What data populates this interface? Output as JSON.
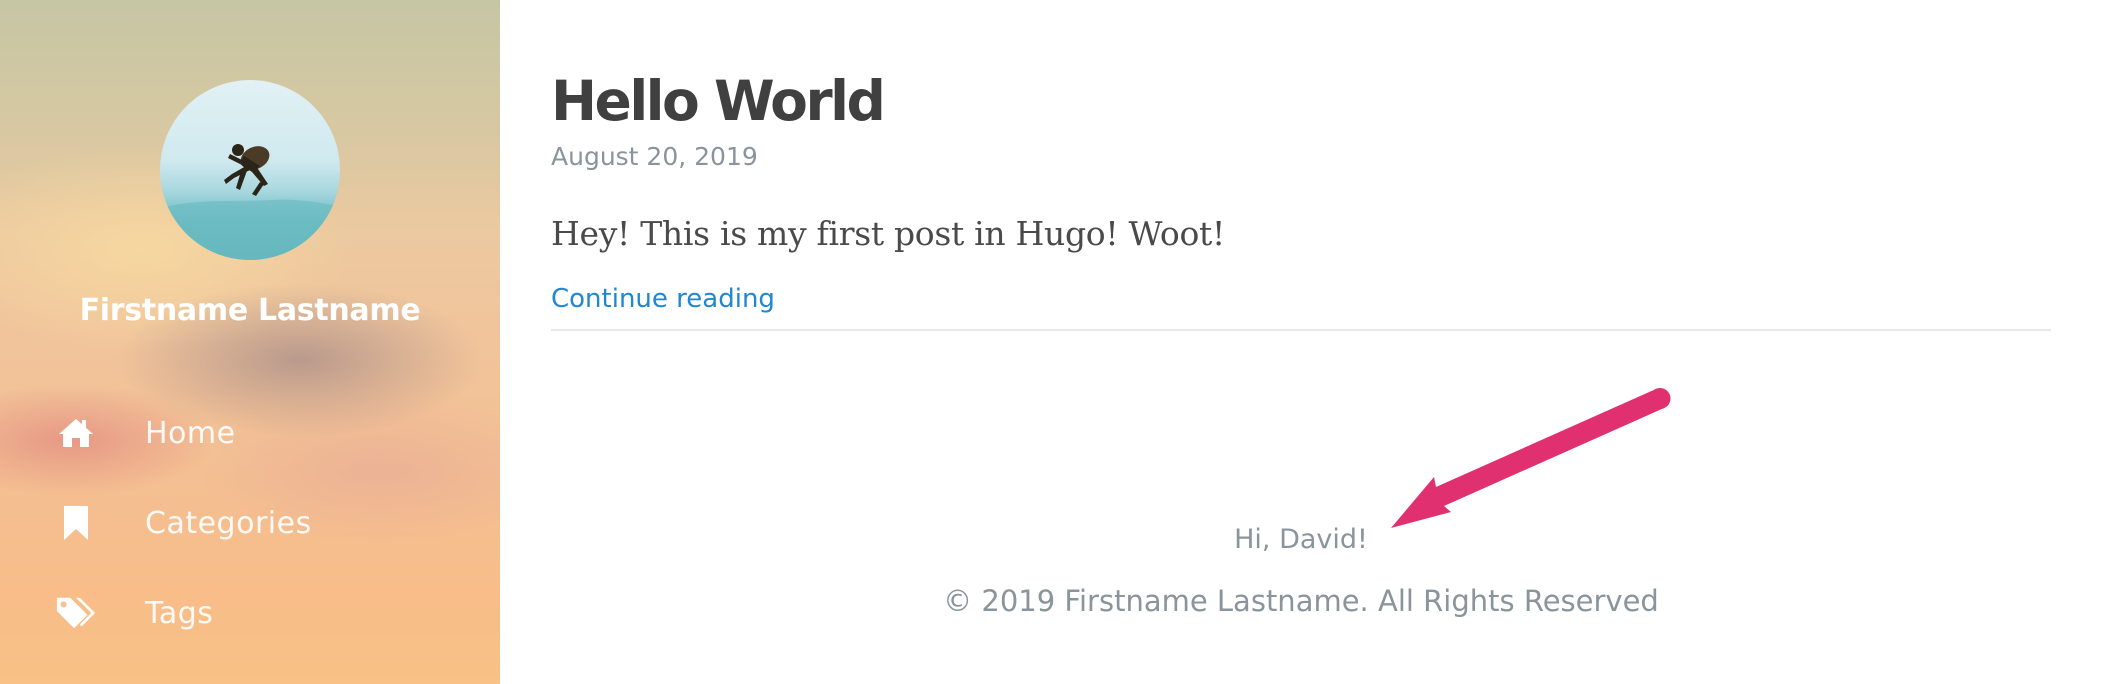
{
  "sidebar": {
    "author_name": "Firstname Lastname",
    "nav": [
      {
        "label": "Home",
        "icon": "home-icon"
      },
      {
        "label": "Categories",
        "icon": "bookmark-icon"
      },
      {
        "label": "Tags",
        "icon": "tags-icon"
      }
    ]
  },
  "post": {
    "title": "Hello World",
    "date": "August 20, 2019",
    "summary": "Hey! This is my first post in Hugo! Woot!",
    "continue_label": "Continue reading"
  },
  "footer": {
    "greeting": "Hi, David!",
    "copyright": "© 2019 Firstname Lastname. All Rights Reserved"
  },
  "colors": {
    "link": "#2187d0",
    "title": "#404040",
    "muted": "#8a949b",
    "annotation_arrow": "#e0306f"
  }
}
